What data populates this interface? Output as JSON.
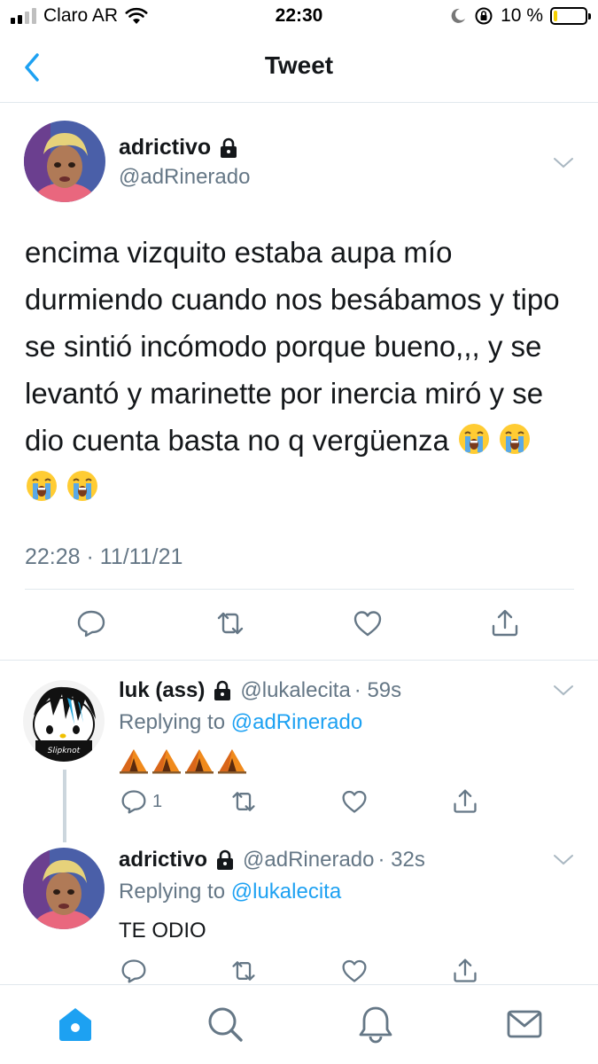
{
  "status_bar": {
    "carrier": "Claro AR",
    "time": "22:30",
    "battery_percent": "10 %",
    "battery_level": 0.1
  },
  "header": {
    "title": "Tweet"
  },
  "main_tweet": {
    "display_name": "adrictivo",
    "handle": "@adRinerado",
    "text": "encima vizquito estaba aupa mío durmiendo cuando nos besábamos y tipo se sintió incómodo porque bueno,,, y se levantó y marinette por inercia miró y se dio cuenta basta no q vergüenza",
    "emojis": [
      "crying-face",
      "crying-face",
      "crying-face",
      "crying-face"
    ],
    "timestamp": "22:28 · 11/11/21"
  },
  "replies": [
    {
      "display_name": "luk (ass)",
      "handle": "@lukalecita",
      "age": "· 59s",
      "replying_prefix": "Replying to",
      "replying_to": "@adRinerado",
      "body_emojis": [
        "tent",
        "tent",
        "tent",
        "tent"
      ],
      "reply_count": "1"
    },
    {
      "display_name": "adrictivo",
      "handle": "@adRinerado",
      "age": "· 32s",
      "replying_prefix": "Replying to",
      "replying_to": "@lukalecita",
      "body": "TE ODIO"
    }
  ],
  "colors": {
    "accent": "#1da1f2",
    "secondary_text": "#657786",
    "icon": "#657786"
  },
  "tab_bar": {
    "tabs": [
      "home-icon",
      "search-icon",
      "notifications-icon",
      "messages-icon"
    ],
    "active": "home-icon"
  }
}
